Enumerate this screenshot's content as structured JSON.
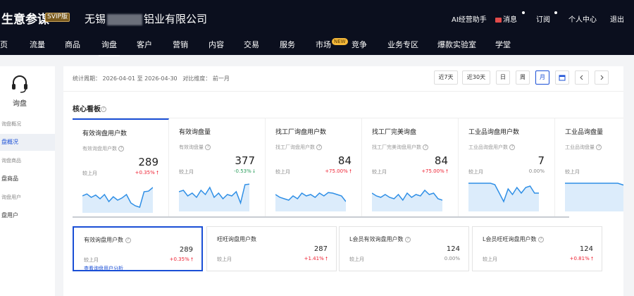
{
  "header": {
    "brand": "生意参谋",
    "badge": "SVIP版",
    "shop_prefix": "无锡",
    "shop_suffix": "铝业有限公司",
    "links": [
      "AI经营助手",
      "消息",
      "订阅",
      "个人中心",
      "退出"
    ]
  },
  "nav": {
    "items": [
      "页",
      "流量",
      "商品",
      "询盘",
      "客户",
      "营销",
      "内容",
      "交易",
      "服务",
      "市场",
      "竞争",
      "业务专区",
      "爆款实验室",
      "学堂"
    ],
    "active": "询盘",
    "new_badge": "NEW"
  },
  "sidebar": {
    "title": "询盘",
    "items": [
      "询盘概况",
      "盘概况",
      "询盘商品",
      "盘商品",
      "询盘用户",
      "盘用户"
    ]
  },
  "period": {
    "label": "统计周期：",
    "start": "2026-04-01",
    "to": "至",
    "end": "2026-04-30",
    "compare_label": "对比维度：",
    "compare_value": "前一月",
    "buttons": [
      "近7天",
      "近30天",
      "日",
      "周",
      "月"
    ],
    "active_button": "月"
  },
  "section": {
    "title": "核心看板"
  },
  "metric_tabs": [
    {
      "title": "有效询盘用户数",
      "sub": "有效询盘用户数",
      "value": "289",
      "rate_label": "较上月",
      "rate": "+0.35%",
      "trend": "up"
    },
    {
      "title": "有效询盘量",
      "sub": "有效询盘量",
      "value": "377",
      "rate_label": "较上月",
      "rate": "-0.53%",
      "trend": "down"
    },
    {
      "title": "找工厂询盘用户数",
      "sub": "找工厂询盘用户数",
      "value": "84",
      "rate_label": "较上月",
      "rate": "+75.00%",
      "trend": "up"
    },
    {
      "title": "找工厂完美询盘",
      "sub": "找工厂完美询盘用户数",
      "value": "84",
      "rate_label": "较上月",
      "rate": "+75.00%",
      "trend": "up"
    },
    {
      "title": "工业品询盘用户数",
      "sub": "工业品询盘用户数",
      "value": "7",
      "rate_label": "较上月",
      "rate": "0.00%",
      "trend": "flat"
    },
    {
      "title": "工业品询盘量",
      "sub": "工业品询盘量",
      "value": "",
      "rate_label": "较上月",
      "rate": "",
      "trend": "flat"
    }
  ],
  "sparklines": [
    [
      0.55,
      0.62,
      0.5,
      0.58,
      0.45,
      0.6,
      0.35,
      0.52,
      0.4,
      0.48,
      0.6,
      0.3,
      0.2,
      0.15,
      0.7,
      0.72,
      0.85
    ],
    [
      0.65,
      0.7,
      0.5,
      0.6,
      0.45,
      0.7,
      0.55,
      0.8,
      0.45,
      0.6,
      0.4,
      0.55,
      0.5,
      0.65,
      0.25,
      0.9,
      0.92
    ],
    [
      0.55,
      0.45,
      0.4,
      0.35,
      0.5,
      0.4,
      0.6,
      0.5,
      0.55,
      0.45,
      0.6,
      0.5,
      0.62,
      0.6,
      0.55,
      0.5,
      0.3
    ],
    [
      0.6,
      0.5,
      0.45,
      0.55,
      0.45,
      0.4,
      0.55,
      0.35,
      0.6,
      0.45,
      0.55,
      0.5,
      0.7,
      0.55,
      0.6,
      0.4,
      0.35
    ],
    [
      0.95,
      0.95,
      0.95,
      0.95,
      0.95,
      0.95,
      0.9,
      0.6,
      0.3,
      0.75,
      0.55,
      0.8,
      0.6,
      0.8,
      0.85,
      0.6,
      0.6
    ],
    [
      0.95,
      0.95,
      0.95,
      0.95,
      0.95,
      0.95,
      0.95,
      0.95,
      0.95,
      0.95,
      0.95,
      0.95,
      0.95,
      0.9,
      0.85,
      0.7,
      0.2
    ]
  ],
  "sub_metrics": [
    {
      "title": "有效询盘用户数",
      "value": "289",
      "rate_label": "较上月",
      "rate": "+0.35%",
      "trend": "up",
      "link": "查看询盘用户分析"
    },
    {
      "title": "旺旺询盘用户数",
      "value": "287",
      "rate_label": "较上月",
      "rate": "+1.41%",
      "trend": "up"
    },
    {
      "title": "L会员有效询盘用户数",
      "value": "124",
      "rate_label": "较上月",
      "rate": "0.00%",
      "trend": "flat"
    },
    {
      "title": "L会员旺旺询盘用户数",
      "value": "124",
      "rate_label": "较上月",
      "rate": "+0.81%",
      "trend": "up"
    }
  ],
  "colors": {
    "accent": "#1a4fd6",
    "up": "#ee2233",
    "down": "#2a9d5c",
    "header_bg": "#0b0f1e",
    "spark_line": "#2f8fe6",
    "spark_fill": "#dcecfb"
  }
}
